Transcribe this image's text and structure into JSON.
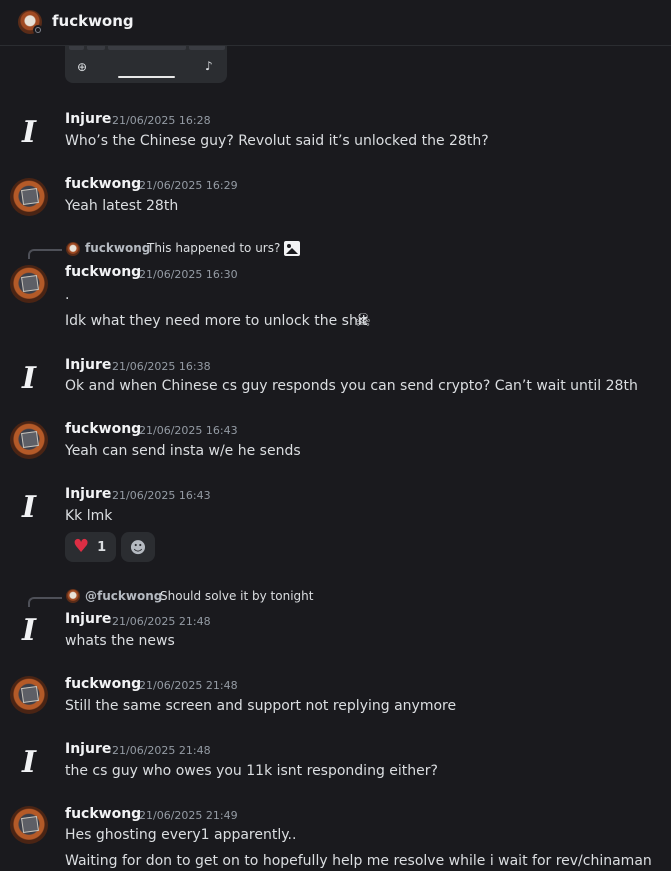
{
  "header": {
    "title": "fuckwong",
    "status_icon": "idle-status-icon"
  },
  "keyboard_preview": {
    "globe_icon": "globe-icon",
    "mic_icon": "microphone-icon"
  },
  "messages": [
    {
      "author": "Injure",
      "time": "21/06/2025 16:28",
      "lines": [
        "Who’s the Chinese guy? Revolut said it’s unlocked the 28th?"
      ]
    },
    {
      "author": "fuckwong",
      "time": "21/06/2025 16:29",
      "lines": [
        "Yeah latest 28th"
      ]
    },
    {
      "author": "fuckwong",
      "time": "21/06/2025 16:30",
      "reply": {
        "author": "fuckwong",
        "text": "This happened to urs?",
        "icon": "image-icon"
      },
      "lines": [
        ".",
        "Idk what they need more to unlock the shit"
      ],
      "emoji": "skull-emoji"
    },
    {
      "author": "Injure",
      "time": "21/06/2025 16:38",
      "lines": [
        "Ok and when Chinese cs guy responds you can send crypto? Can’t wait until 28th"
      ]
    },
    {
      "author": "fuckwong",
      "time": "21/06/2025 16:43",
      "lines": [
        "Yeah can send insta w/e he sends"
      ]
    },
    {
      "author": "Injure",
      "time": "21/06/2025 16:43",
      "lines": [
        "Kk lmk"
      ],
      "reaction": {
        "emoji": "red-heart",
        "count": "1"
      }
    },
    {
      "author": "Injure",
      "time": "21/06/2025 21:48",
      "reply": {
        "author": "@fuckwong",
        "text": "Should solve it by tonight"
      },
      "lines": [
        "whats the news"
      ]
    },
    {
      "author": "fuckwong",
      "time": "21/06/2025 21:48",
      "lines": [
        "Still the same screen and support not replying anymore"
      ]
    },
    {
      "author": "Injure",
      "time": "21/06/2025 21:48",
      "lines": [
        "the cs guy who owes you 11k isnt responding either?"
      ]
    },
    {
      "author": "fuckwong",
      "time": "21/06/2025 21:49",
      "lines": [
        "Hes ghosting every1 apparently..",
        "Waiting for don to get on to hopefully help me resolve while i wait for rev/chinaman"
      ]
    }
  ],
  "injure_avatar_glyph": "I"
}
